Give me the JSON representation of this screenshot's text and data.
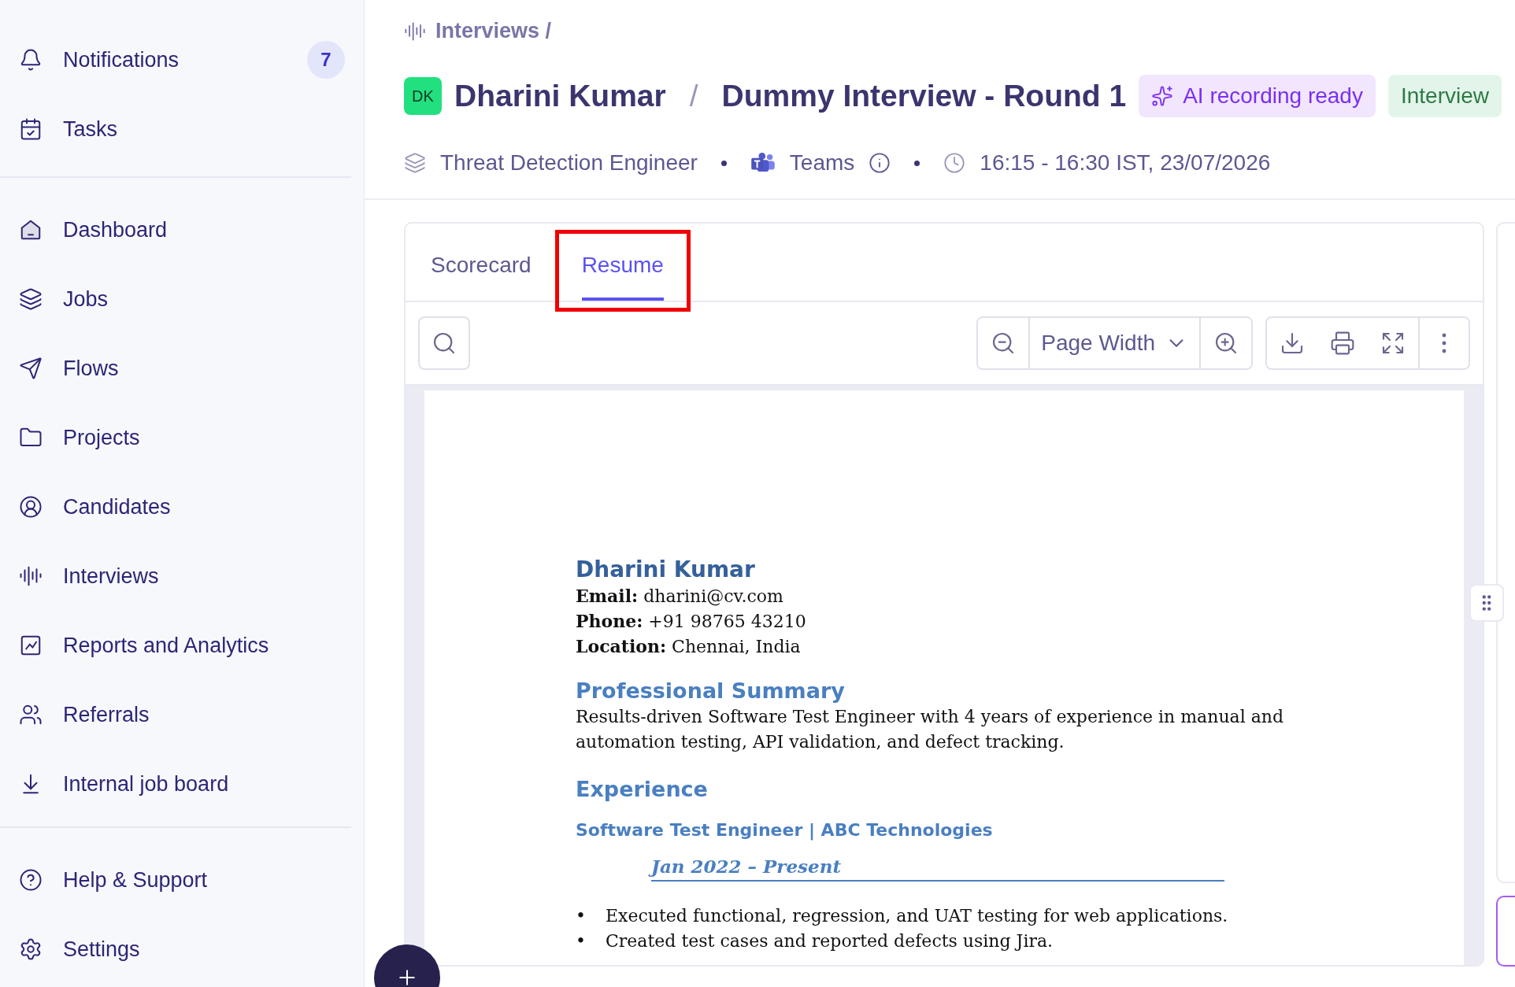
{
  "sidebar": {
    "top_items": [
      {
        "label": "Notifications",
        "badge": "7"
      },
      {
        "label": "Tasks"
      }
    ],
    "nav_items": [
      {
        "label": "Dashboard"
      },
      {
        "label": "Jobs"
      },
      {
        "label": "Flows"
      },
      {
        "label": "Projects"
      },
      {
        "label": "Candidates"
      },
      {
        "label": "Interviews"
      },
      {
        "label": "Reports and Analytics"
      },
      {
        "label": "Referrals"
      },
      {
        "label": "Internal job board"
      }
    ],
    "bottom_items": [
      {
        "label": "Help & Support"
      },
      {
        "label": "Settings"
      }
    ]
  },
  "header": {
    "breadcrumb": "Interviews /",
    "avatar": "DK",
    "candidate": "Dharini Kumar",
    "separator": "/",
    "interview": "Dummy Interview - Round 1",
    "badges": [
      {
        "kind": "ai",
        "label": "AI recording ready"
      },
      {
        "kind": "status",
        "label": "Interview"
      }
    ],
    "meta": {
      "role": "Threat Detection Engineer",
      "platform": "Teams",
      "time": "16:15 - 16:30 IST, 23/07/2026"
    }
  },
  "tabs": [
    {
      "label": "Scorecard",
      "selected": false,
      "highlighted": false
    },
    {
      "label": "Resume",
      "selected": true,
      "highlighted": true
    }
  ],
  "viewer": {
    "zoom": "Page Width"
  },
  "resume": {
    "name": "Dharini Kumar",
    "contacts": [
      "**Email:** dharini@cv.com",
      "**Phone:** +91 98765 43210",
      "**Location:** Chennai, India"
    ],
    "summary_heading": "Professional Summary",
    "summary": "Results-driven Software Test Engineer with 4 years of experience in manual and automation testing, API validation, and defect tracking.",
    "experience_heading": "Experience",
    "job_title": "Software Test Engineer | ABC Technologies",
    "dates": "Jan 2022 – Present",
    "bullet_marker": "•",
    "bullets": [
      "Executed functional, regression, and UAT testing for web applications.",
      "Created test cases and reported defects using Jira."
    ]
  }
}
